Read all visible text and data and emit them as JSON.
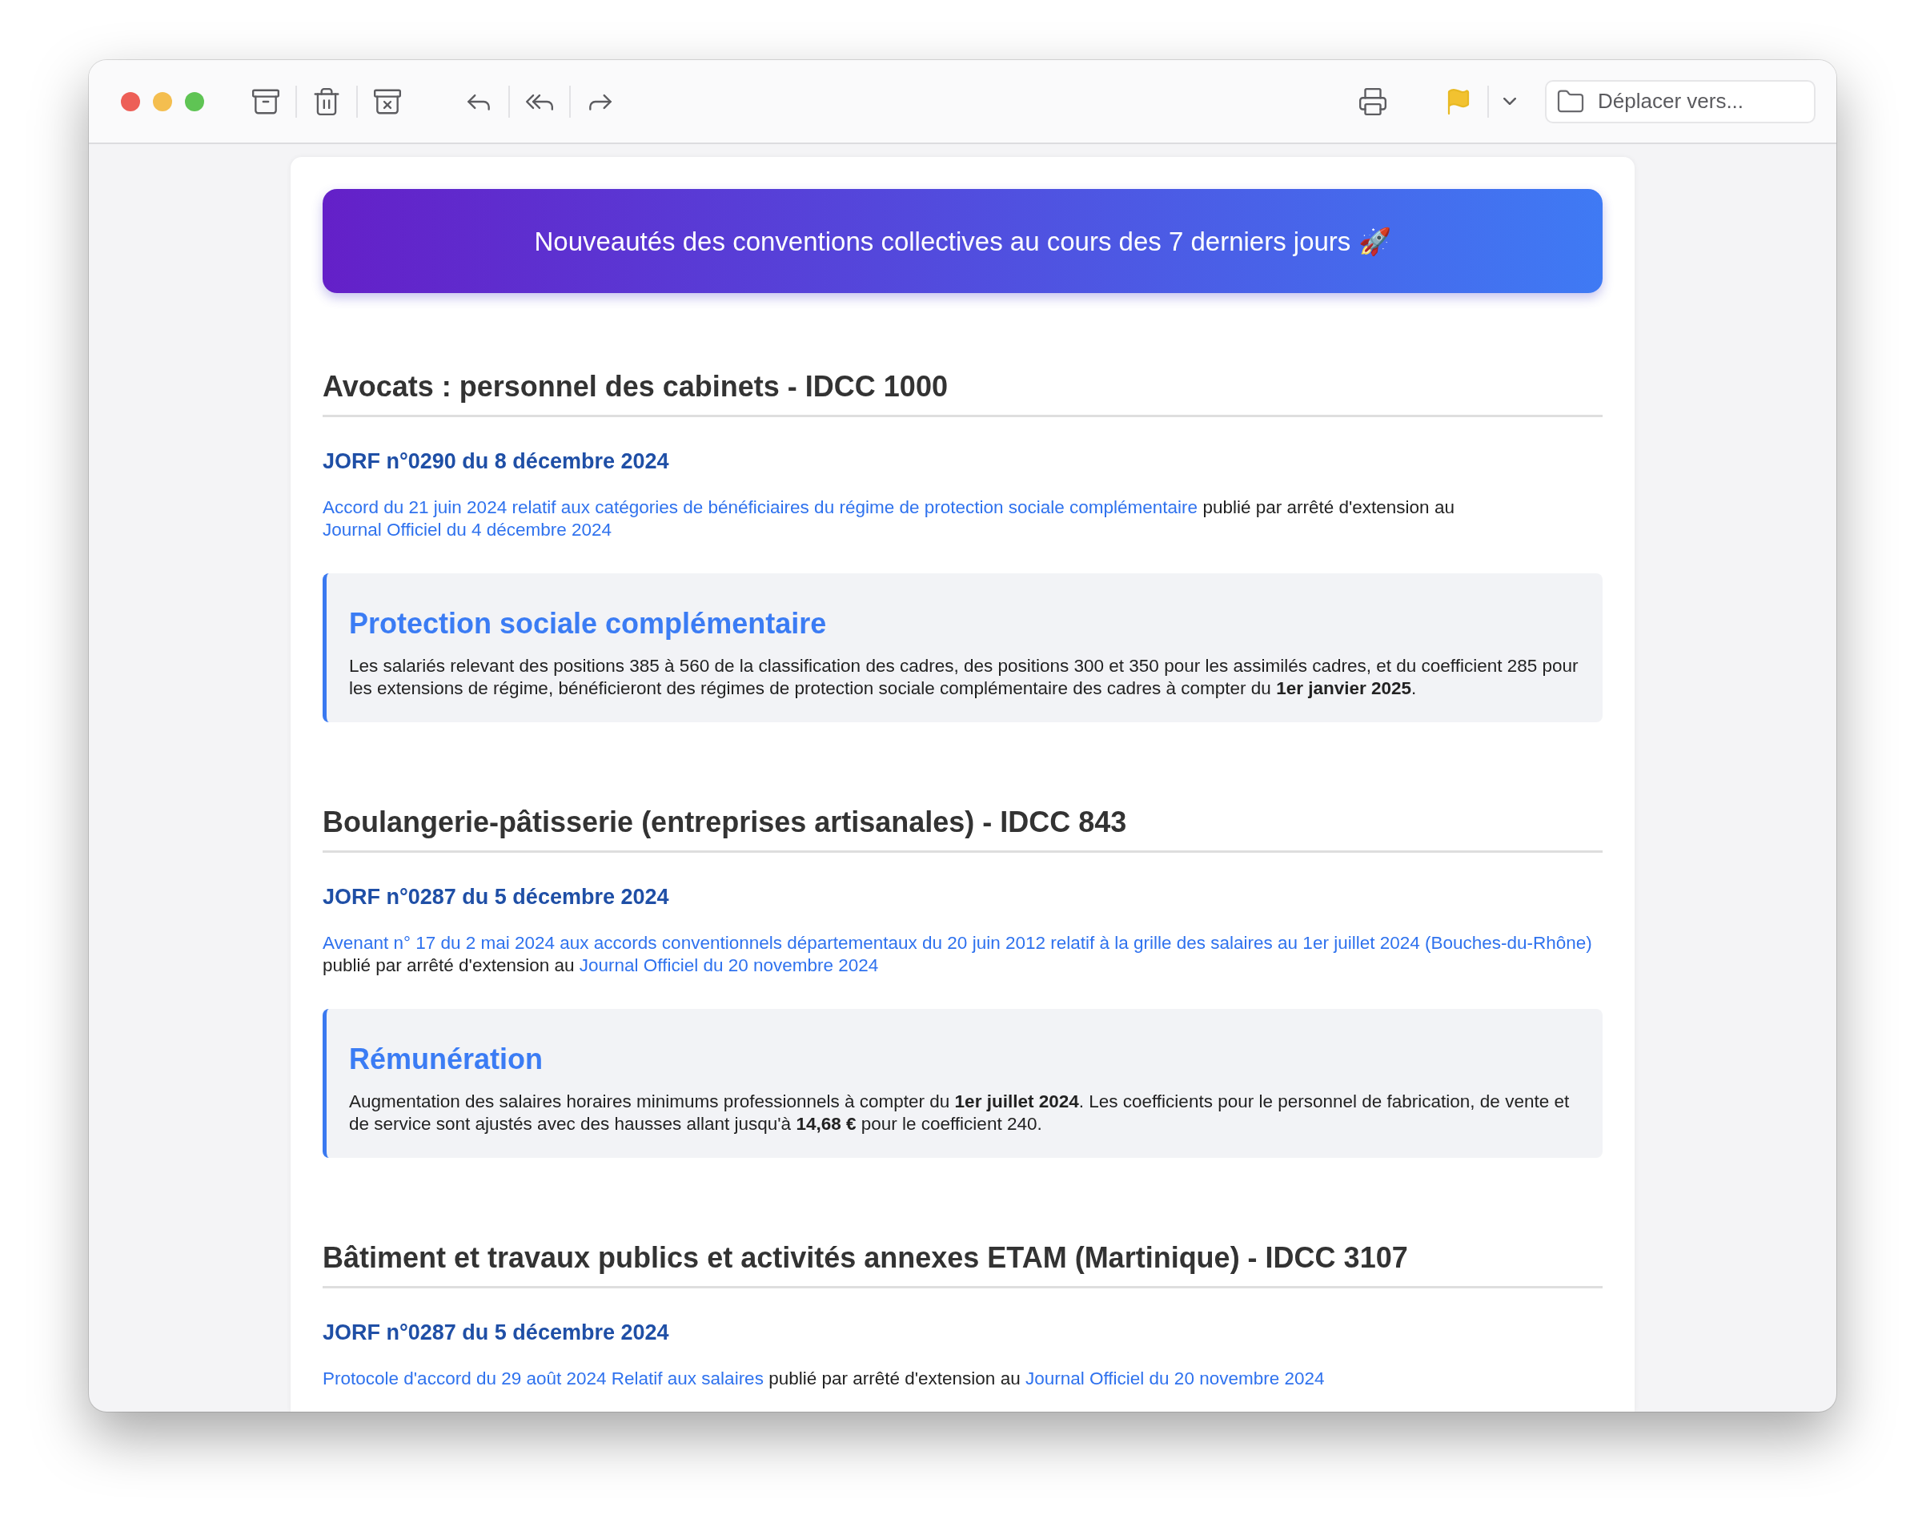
{
  "toolbar": {
    "move_field": {
      "placeholder": "Déplacer vers..."
    }
  },
  "banner": {
    "text": "Nouveautés des conventions collectives au cours des 7 derniers jours 🚀"
  },
  "sections": [
    {
      "title": "Avocats : personnel des cabinets - IDCC 1000",
      "jorf": "JORF n°0290 du 8 décembre 2024",
      "paragraph": [
        {
          "text": "Accord du 21 juin 2024 relatif aux catégories de bénéficiaires du régime de protection sociale complémentaire",
          "link": true
        },
        {
          "text": "publié par arrêté d'extension au",
          "link": false
        },
        {
          "text": "Journal Officiel du 4 décembre 2024",
          "link": true
        }
      ],
      "highlight": {
        "title": "Protection sociale complémentaire",
        "body": "Les salariés relevant des positions 385 à 560 de la classification des cadres, des positions 300 et 350 pour les assimilés cadres, et du coefficient 285 pour les extensions de régime, bénéficieront des régimes de protection sociale complémentaire des cadres à compter du **1er janvier 2025**."
      }
    },
    {
      "title": "Boulangerie-pâtisserie (entreprises artisanales) - IDCC 843",
      "jorf": "JORF n°0287 du 5 décembre 2024",
      "paragraph": [
        {
          "text": "Avenant n° 17 du 2 mai 2024 aux accords conventionnels départementaux du 20 juin 2012 relatif à la grille des salaires au 1er juillet 2024 (Bouches-du-Rhône)",
          "link": true
        },
        {
          "text": "publié par arrêté d'extension au",
          "link": false
        },
        {
          "text": "Journal Officiel du 20 novembre 2024",
          "link": true
        }
      ],
      "highlight": {
        "title": "Rémunération",
        "body": "Augmentation des salaires horaires minimums professionnels à compter du **1er juillet 2024**. Les coefficients pour le personnel de fabrication, de vente et de service sont ajustés avec des hausses allant jusqu'à **14,68 €** pour le coefficient 240."
      }
    },
    {
      "title": "Bâtiment et travaux publics et activités annexes ETAM (Martinique) - IDCC 3107",
      "jorf": "JORF n°0287 du 5 décembre 2024",
      "paragraph": [
        {
          "text": "Protocole d'accord du 29 août 2024 Relatif aux salaires",
          "link": true
        },
        {
          "text": "publié par arrêté d'extension au",
          "link": false
        },
        {
          "text": "Journal Officiel du 20 novembre 2024",
          "link": true
        }
      ]
    }
  ]
}
